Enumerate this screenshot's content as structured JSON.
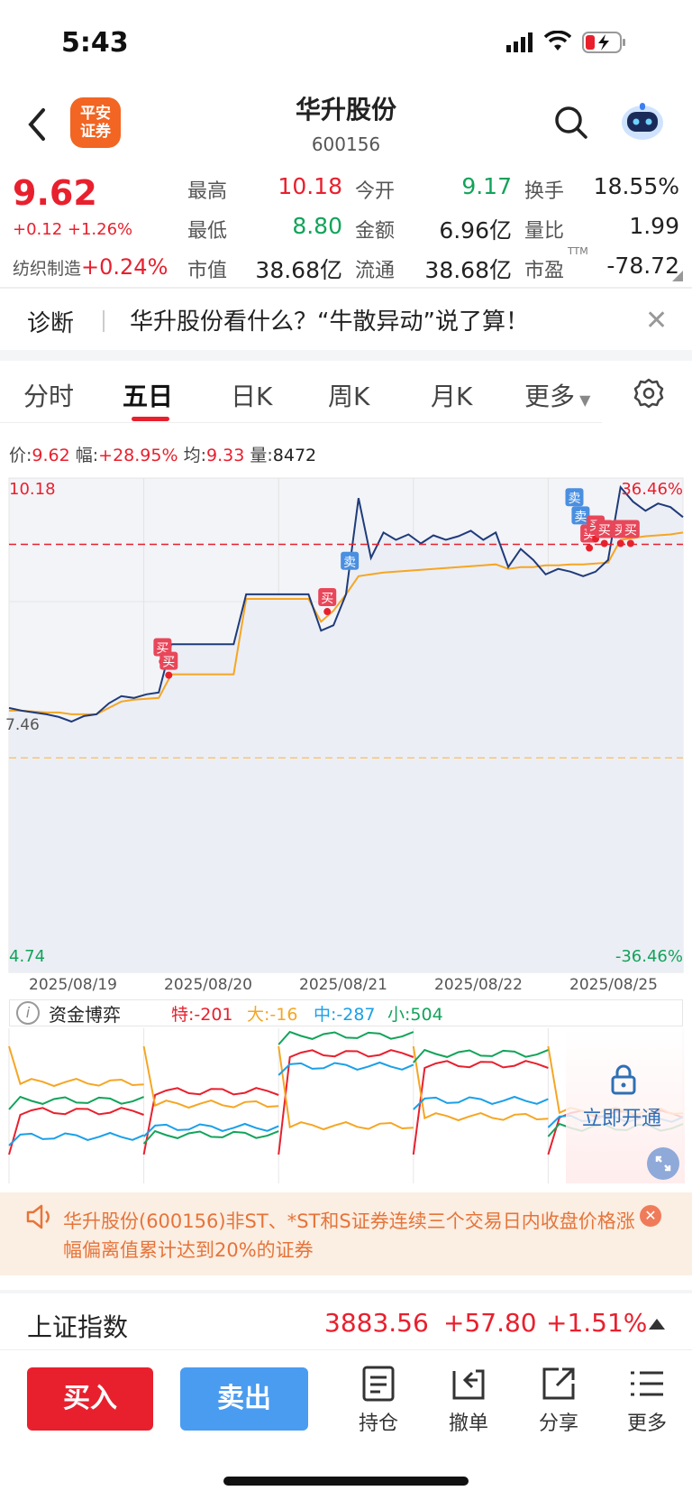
{
  "status_bar": {
    "time": "5:43"
  },
  "header": {
    "broker_logo": "平安\n证券",
    "name": "华升股份",
    "code": "600156"
  },
  "quote": {
    "price": "9.62",
    "change": "+0.12 +1.26%",
    "sector_name": "纺织制造",
    "sector_change": "+0.24%",
    "fields": [
      {
        "label": "最高",
        "value": "10.18",
        "color": "red"
      },
      {
        "label": "今开",
        "value": "9.17",
        "color": "green"
      },
      {
        "label": "换手",
        "value": "18.55%",
        "color": "dark"
      },
      {
        "label": "最低",
        "value": "8.80",
        "color": "green"
      },
      {
        "label": "金额",
        "value": "6.96亿",
        "color": "dark"
      },
      {
        "label": "量比",
        "value": "1.99",
        "color": "dark"
      },
      {
        "label": "市值",
        "value": "38.68亿",
        "color": "dark"
      },
      {
        "label": "流通",
        "value": "38.68亿",
        "color": "dark"
      },
      {
        "label": "市盈",
        "value": "-78.72",
        "color": "dark"
      }
    ],
    "ttm": "TTM"
  },
  "diagnosis": {
    "label": "诊断",
    "text": "华升股份看什么？“牛散异动”说了算！",
    "close": "✕"
  },
  "tabs": [
    "分时",
    "五日",
    "日K",
    "周K",
    "月K",
    "更多"
  ],
  "active_tab": "五日",
  "info_line": {
    "price_label": "价:",
    "price": "9.62",
    "range_label": "幅:",
    "range": "+28.95%",
    "avg_label": "均:",
    "avg": "9.33",
    "vol_label": "量:",
    "vol": "8472"
  },
  "chart_data": {
    "type": "line",
    "y_axis": {
      "top_label": "10.18",
      "ref_label": "7.46",
      "bottom_label": "4.74",
      "top_pct": "36.46%",
      "bottom_pct": "-36.46%"
    },
    "ylim": [
      4.74,
      10.18
    ],
    "reference_price": 7.46,
    "dates": [
      "2025/08/19",
      "2025/08/20",
      "2025/08/21",
      "2025/08/22",
      "2025/08/25"
    ],
    "series": [
      {
        "color": "#1f3b7a",
        "values": [
          7.65,
          7.62,
          7.6,
          7.58,
          7.55,
          7.5,
          7.56,
          7.58,
          7.7,
          7.78,
          7.76,
          7.8,
          7.82,
          8.35,
          8.35,
          8.35,
          8.35,
          8.35,
          8.35,
          8.9,
          8.9,
          8.9,
          8.9,
          8.9,
          8.9,
          8.5,
          8.56,
          8.9,
          9.96,
          9.3,
          9.58,
          9.5,
          9.56,
          9.46,
          9.55,
          9.5,
          9.54,
          9.6,
          9.5,
          9.58,
          9.2,
          9.4,
          9.28,
          9.12,
          9.18,
          9.15,
          9.1,
          9.15,
          9.28,
          10.08,
          9.92,
          9.82,
          9.9,
          9.86,
          9.75
        ]
      },
      {
        "color": "#f5a623",
        "values": [
          7.62,
          7.62,
          7.61,
          7.6,
          7.6,
          7.58,
          7.58,
          7.58,
          7.65,
          7.72,
          7.74,
          7.75,
          7.76,
          8.02,
          8.02,
          8.02,
          8.02,
          8.02,
          8.02,
          8.85,
          8.85,
          8.85,
          8.85,
          8.85,
          8.85,
          8.6,
          8.72,
          8.9,
          9.1,
          9.12,
          9.14,
          9.15,
          9.16,
          9.17,
          9.18,
          9.19,
          9.2,
          9.21,
          9.22,
          9.23,
          9.18,
          9.2,
          9.2,
          9.22,
          9.22,
          9.23,
          9.23,
          9.24,
          9.25,
          9.5,
          9.52,
          9.54,
          9.55,
          9.56,
          9.58
        ]
      }
    ],
    "markers": {
      "buy": "买",
      "sell": "卖"
    }
  },
  "fund_game": {
    "title": "资金博弈",
    "stats": [
      {
        "text": "特:-201",
        "color": "#e8202e"
      },
      {
        "text": "大:-16",
        "color": "#f5a623"
      },
      {
        "text": "中:-287",
        "color": "#1aa0e8"
      },
      {
        "text": "小:504",
        "color": "#12a35a"
      }
    ],
    "unlock": "立即开通"
  },
  "warning": {
    "text": "华升股份(600156)非ST、*ST和S证券连续三个交易日内收盘价格涨幅偏离值累计达到20%的证券",
    "close": "✕"
  },
  "index": {
    "name": "上证指数",
    "value": "3883.56",
    "change": "+57.80",
    "pct": "+1.51%"
  },
  "bottom_bar": {
    "buy": "买入",
    "sell": "卖出",
    "tools": [
      "持仓",
      "撤单",
      "分享",
      "更多"
    ]
  }
}
